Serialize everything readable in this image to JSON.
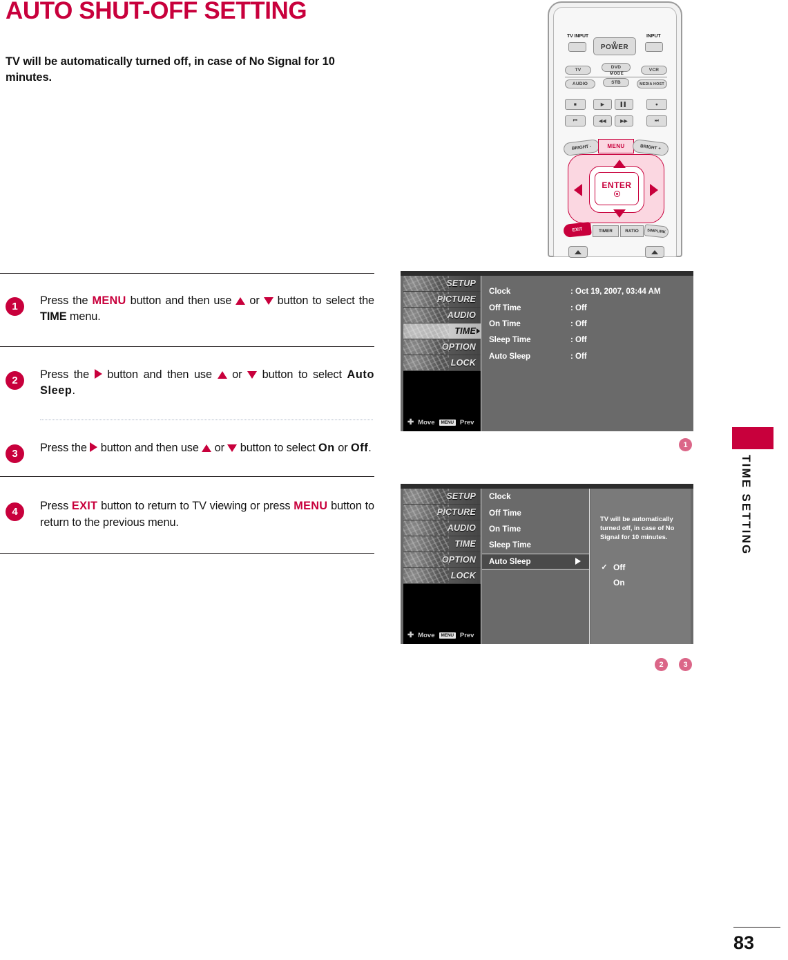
{
  "document": {
    "title": "AUTO SHUT-OFF SETTING",
    "intro": "TV will be automatically turned off, in case of No Signal for 10 minutes.",
    "page_number": "83",
    "side_tab_label": "TIME SETTING",
    "accent_color": "#c8003c"
  },
  "remote": {
    "tv_input": "TV INPUT",
    "input": "INPUT",
    "power": "POWER",
    "mode": "MODE",
    "sources": [
      "TV",
      "DVD",
      "VCR",
      "AUDIO",
      "STB",
      "MEDIA HOST"
    ],
    "bright_minus": "BRIGHT -",
    "bright_plus": "BRIGHT +",
    "menu": "MENU",
    "enter": "ENTER",
    "exit": "EXIT",
    "timer": "TIMER",
    "ratio": "RATIO",
    "simplink": "SIMPLINK"
  },
  "steps": [
    {
      "number": "1",
      "parts": [
        {
          "t": "Press the ",
          "s": "n"
        },
        {
          "t": "MENU",
          "s": "kw"
        },
        {
          "t": " button and then use ",
          "s": "n"
        },
        {
          "t": "",
          "s": "tri-u"
        },
        {
          "t": " or ",
          "s": "n"
        },
        {
          "t": "",
          "s": "tri-d"
        },
        {
          "t": " button to select the ",
          "s": "n"
        },
        {
          "t": "TIME",
          "s": "bk"
        },
        {
          "t": " menu.",
          "s": "n"
        }
      ]
    },
    {
      "number": "2",
      "parts": [
        {
          "t": "Press the ",
          "s": "n"
        },
        {
          "t": "",
          "s": "tri-r"
        },
        {
          "t": " button and then use ",
          "s": "n"
        },
        {
          "t": "",
          "s": "tri-u"
        },
        {
          "t": " or ",
          "s": "n"
        },
        {
          "t": "",
          "s": "tri-d"
        },
        {
          "t": " button to select ",
          "s": "n"
        },
        {
          "t": "Auto Sleep",
          "s": "bk-sp"
        },
        {
          "t": ".",
          "s": "n"
        }
      ]
    },
    {
      "number": "3",
      "parts": [
        {
          "t": "Press the ",
          "s": "n"
        },
        {
          "t": "",
          "s": "tri-r"
        },
        {
          "t": " button and then use ",
          "s": "n"
        },
        {
          "t": "",
          "s": "tri-u"
        },
        {
          "t": " or ",
          "s": "n"
        },
        {
          "t": "",
          "s": "tri-d"
        },
        {
          "t": " button to select ",
          "s": "n"
        },
        {
          "t": "On",
          "s": "bk-sp"
        },
        {
          "t": " or ",
          "s": "n"
        },
        {
          "t": "Off",
          "s": "bk-sp"
        },
        {
          "t": ".",
          "s": "n"
        }
      ]
    },
    {
      "number": "4",
      "parts": [
        {
          "t": "Press ",
          "s": "n"
        },
        {
          "t": "EXIT",
          "s": "kw"
        },
        {
          "t": " button to return to TV viewing or press ",
          "s": "n"
        },
        {
          "t": "MENU",
          "s": "kw"
        },
        {
          "t": " button to return to the previous menu.",
          "s": "n"
        }
      ]
    }
  ],
  "osd_menus": [
    {
      "id": "osd1",
      "callout": "1",
      "sidebar": {
        "items": [
          "SETUP",
          "PICTURE",
          "AUDIO",
          "TIME",
          "OPTION",
          "LOCK"
        ],
        "active": "TIME",
        "footer_move": "Move",
        "footer_menu_chip": "MENU",
        "footer_prev": "Prev"
      },
      "rows": [
        {
          "label": "Clock",
          "value": ": Oct 19, 2007, 03:44 AM"
        },
        {
          "label": "Off Time",
          "value": ": Off"
        },
        {
          "label": "On Time",
          "value": ": Off"
        },
        {
          "label": "Sleep Time",
          "value": ": Off"
        },
        {
          "label": "Auto Sleep",
          "value": ": Off"
        }
      ]
    },
    {
      "id": "osd2",
      "callouts": [
        "2",
        "3"
      ],
      "sidebar": {
        "items": [
          "SETUP",
          "PICTURE",
          "AUDIO",
          "TIME",
          "OPTION",
          "LOCK"
        ],
        "active": "",
        "footer_move": "Move",
        "footer_menu_chip": "MENU",
        "footer_prev": "Prev"
      },
      "rows": [
        {
          "label": "Clock",
          "selected": false
        },
        {
          "label": "Off Time",
          "selected": false
        },
        {
          "label": "On Time",
          "selected": false
        },
        {
          "label": "Sleep Time",
          "selected": false
        },
        {
          "label": "Auto Sleep",
          "selected": true
        }
      ],
      "help_text": "TV will be automatically turned off, in case of No Signal for 10 minutes.",
      "options": [
        {
          "label": "Off",
          "checked": true
        },
        {
          "label": "On",
          "checked": false
        }
      ],
      "check_glyph": "✓"
    }
  ]
}
